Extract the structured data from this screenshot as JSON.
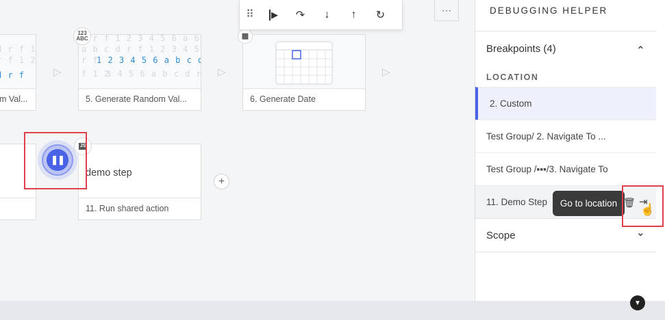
{
  "toolbar": {
    "grip_icon": "⠿",
    "resume_icon": "▶",
    "step_over_icon": "↷",
    "step_into_icon": "↓",
    "step_out_icon": "↑",
    "restart_icon": "↻",
    "more_icon": "⋯"
  },
  "canvas": {
    "code_lines_top": [
      "d r f 1 2 3 4 5 6 a b c d r f 1 2",
      "a b c d r f 1 2 3 4 5 6 a b c d r f"
    ],
    "code_line_highlight_left": "r f",
    "code_line_highlight": "1 2 3 4 5 6 a b c d r f",
    "code_line_after_left": "f 1 2",
    "code_line_after": "3 4 5 6 a b c d r f 1 2",
    "cards": {
      "card_left_top_caption": "m Val...",
      "card_5_caption": "5. Generate Random Val...",
      "card_6_caption": "6. Generate Date",
      "card_11_title": "demo step",
      "card_11_caption": "11. Run shared action"
    },
    "badge_123": "123\nABC",
    "badge_js": "JS",
    "pause_icon": "❚❚",
    "add_icon": "+",
    "arrow_icon": "▷"
  },
  "panel": {
    "title": "DEBUGGING HELPER",
    "breakpoints_header": "Breakpoints (4)",
    "location_label": "LOCATION",
    "breakpoints": [
      "2. Custom",
      "Test Group/ 2. Navigate To ...",
      "Test Group /▪▪▪/3. Navigate To",
      "11. Demo Step"
    ],
    "tooltip": "Go to location",
    "scope_header": "Scope",
    "chevron_up": "⌃",
    "chevron_down": "⌄"
  },
  "colors": {
    "accent": "#4a63e6",
    "highlight_box": "#e0404a"
  }
}
